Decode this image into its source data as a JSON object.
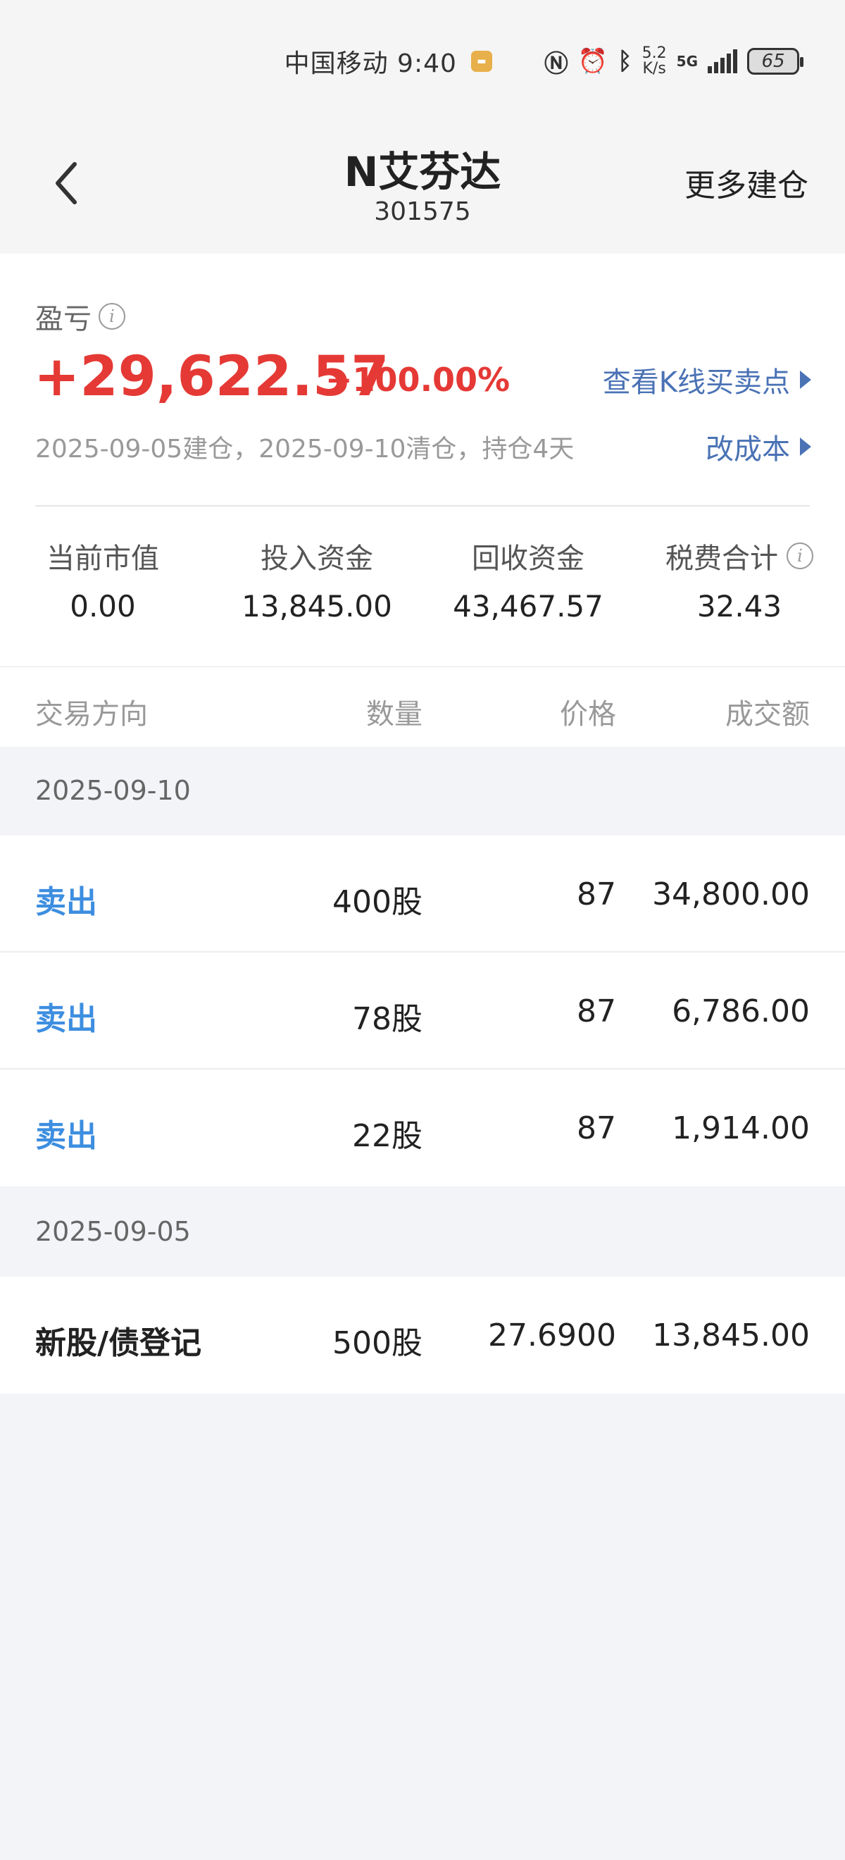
{
  "status_bar": {
    "carrier_time": "中国移动 9:40",
    "net_speed_top": "5.2",
    "net_speed_bottom": "K/s",
    "network": "5G",
    "battery": "65"
  },
  "header": {
    "title": "N艾芬达",
    "code": "301575",
    "more_label": "更多建仓"
  },
  "summary": {
    "pl_label": "盈亏",
    "pl_value": "+29,622.57",
    "pl_percent": "+100.00%",
    "kline_link": "查看K线买卖点",
    "hold_info": "2025-09-05建仓，2025-09-10清仓，持仓4天",
    "cost_link": "改成本",
    "stats": [
      {
        "label": "当前市值",
        "value": "0.00"
      },
      {
        "label": "投入资金",
        "value": "13,845.00"
      },
      {
        "label": "回收资金",
        "value": "43,467.57"
      },
      {
        "label": "税费合计",
        "value": "32.43"
      }
    ]
  },
  "table": {
    "headers": {
      "direction": "交易方向",
      "quantity": "数量",
      "price": "价格",
      "amount": "成交额"
    },
    "groups": [
      {
        "date": "2025-09-10",
        "rows": [
          {
            "direction": "卖出",
            "quantity": "400股",
            "price": "87",
            "amount": "34,800.00"
          },
          {
            "direction": "卖出",
            "quantity": "78股",
            "price": "87",
            "amount": "6,786.00"
          },
          {
            "direction": "卖出",
            "quantity": "22股",
            "price": "87",
            "amount": "1,914.00"
          }
        ]
      },
      {
        "date": "2025-09-05",
        "rows": [
          {
            "direction": "新股/债登记",
            "quantity": "500股",
            "price": "27.6900",
            "amount": "13,845.00"
          }
        ]
      }
    ]
  },
  "colors": {
    "profit_red": "#e53935",
    "link_blue": "#4a72b5",
    "sell_blue": "#3d8ee0"
  }
}
